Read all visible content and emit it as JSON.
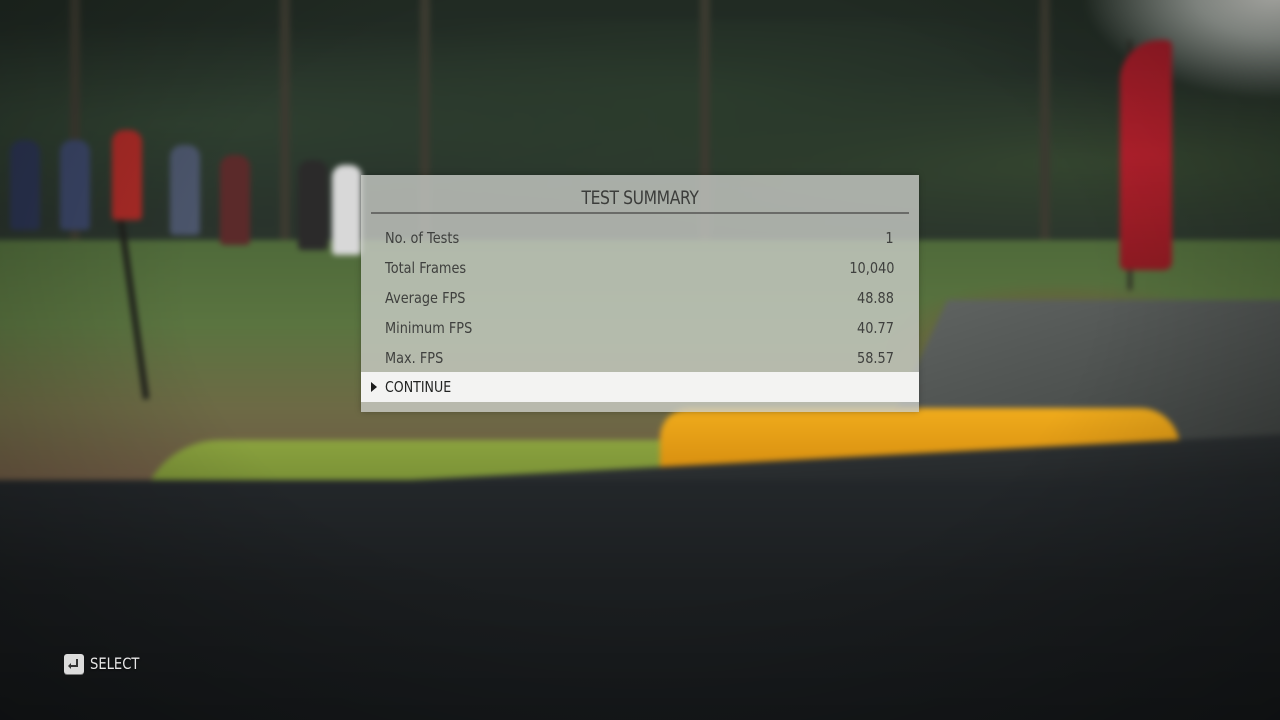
{
  "dialog": {
    "title": "TEST SUMMARY",
    "stats": [
      {
        "label": "No. of Tests",
        "value": "1"
      },
      {
        "label": "Total Frames",
        "value": "10,040"
      },
      {
        "label": "Average FPS",
        "value": "48.88"
      },
      {
        "label": "Minimum FPS",
        "value": "40.77"
      },
      {
        "label": "Max. FPS",
        "value": "58.57"
      }
    ],
    "continue_label": "CONTINUE"
  },
  "prompt": {
    "icon": "enter-key-icon",
    "select_label": "SELECT"
  },
  "colors": {
    "panel": "#cdcfcb",
    "highlight": "#f3f3f2",
    "flag": "#b3202c",
    "hood": "#f0ac1c"
  }
}
